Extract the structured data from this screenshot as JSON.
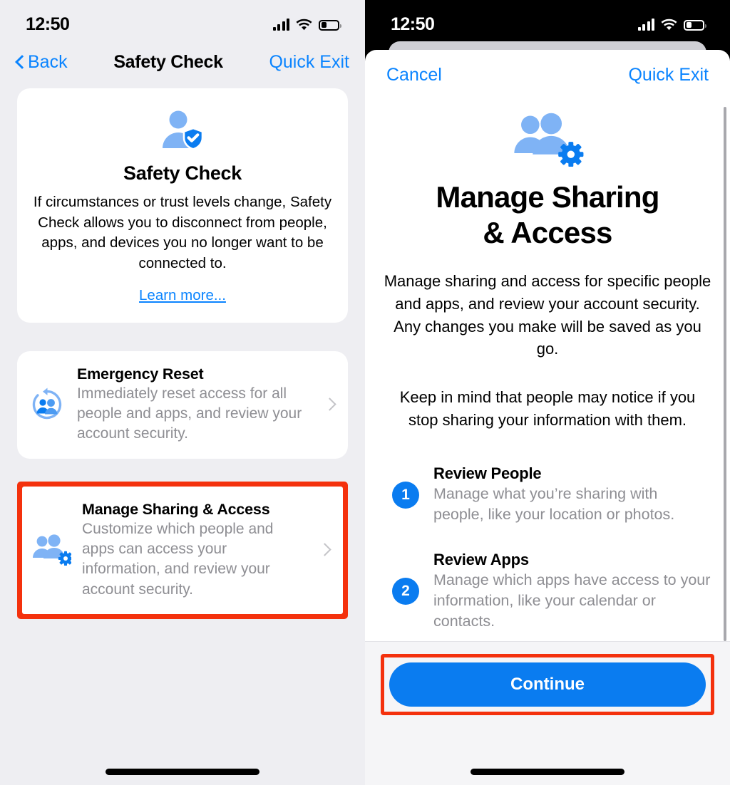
{
  "left_panel": {
    "status_bar": {
      "time": "12:50",
      "signal_icon": "cellular-bars-icon",
      "wifi_icon": "wifi-icon",
      "battery_icon": "battery-low-icon"
    },
    "nav": {
      "back_label": "Back",
      "title": "Safety Check",
      "quick_exit_label": "Quick Exit"
    },
    "hero": {
      "icon": "person-shield-check-icon",
      "title": "Safety Check",
      "description": "If circumstances or trust levels change, Safety Check allows you to disconnect from people, apps, and devices you no longer want to be connected to.",
      "link_label": "Learn more..."
    },
    "rows": [
      {
        "icon": "emergency-reset-icon",
        "title": "Emergency Reset",
        "subtitle": "Immediately reset access for all people and apps, and review your account security.",
        "highlighted": false
      },
      {
        "icon": "manage-sharing-access-icon",
        "title": "Manage Sharing & Access",
        "subtitle": "Customize which people and apps can access your information, and review your account security.",
        "highlighted": true
      }
    ]
  },
  "right_panel": {
    "status_bar": {
      "time": "12:50",
      "signal_icon": "cellular-bars-icon",
      "wifi_icon": "wifi-icon",
      "battery_icon": "battery-low-icon"
    },
    "sheet_nav": {
      "cancel_label": "Cancel",
      "quick_exit_label": "Quick Exit"
    },
    "header": {
      "icon": "manage-sharing-access-icon",
      "title_line1": "Manage Sharing",
      "title_line2": "& Access"
    },
    "paragraphs": [
      "Manage sharing and access for specific people and apps, and review your account security. Any changes you make will be saved as you go.",
      "Keep in mind that people may notice if you stop sharing your information with them."
    ],
    "steps": [
      {
        "number": "1",
        "title": "Review People",
        "description": "Manage what you’re sharing with people, like your location or photos."
      },
      {
        "number": "2",
        "title": "Review Apps",
        "description": "Manage which apps have access to your information, like your calendar or contacts."
      }
    ],
    "cta": {
      "label": "Continue",
      "highlighted": true
    }
  },
  "colors": {
    "accent_blue": "#0a84ff",
    "button_blue": "#0a7cf0",
    "icon_light_blue": "#7fb3f5",
    "icon_dark_blue": "#0a7cf0",
    "highlight_red": "#f4310d",
    "background_gray": "#eeeef2",
    "secondary_text": "#8e8e93"
  }
}
